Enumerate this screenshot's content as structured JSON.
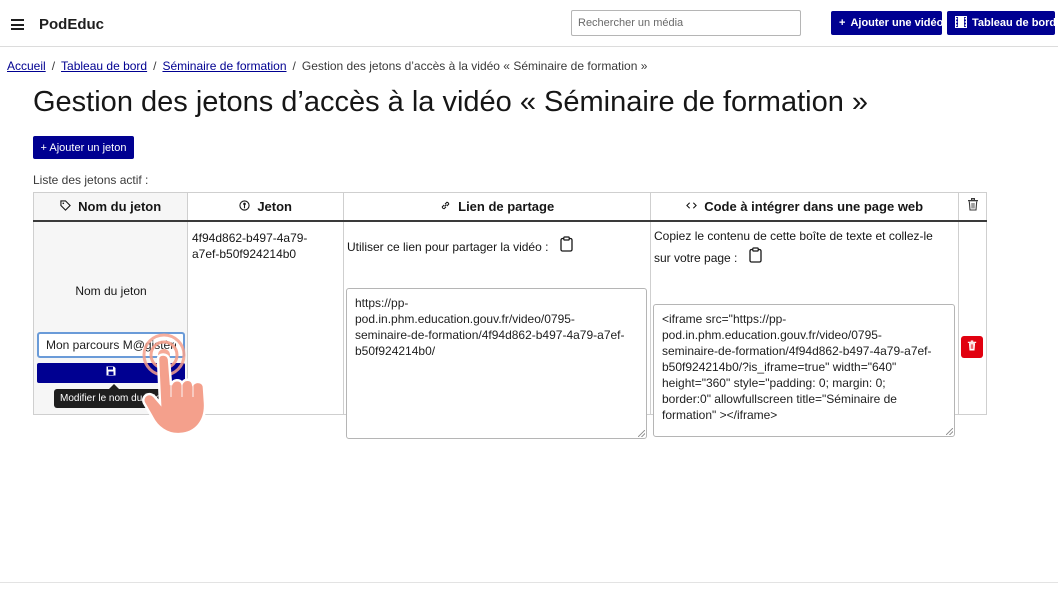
{
  "header": {
    "brand": "PodEduc",
    "search_placeholder": "Rechercher un média",
    "add_media_label": "Ajouter une vidéo",
    "dashboard_label": "Tableau de bord"
  },
  "breadcrumb": {
    "items": [
      "Accueil",
      "Tableau de bord",
      "Séminaire de formation"
    ],
    "current": "Gestion des jetons d’accès à la vidéo « Séminaire de formation »"
  },
  "page": {
    "title": "Gestion des jetons d’accès à la vidéo « Séminaire de formation »",
    "add_token_label": "+ Ajouter un jeton",
    "list_label": "Liste des jetons actif :"
  },
  "table": {
    "headers": {
      "name": "Nom du jeton",
      "token": "Jeton",
      "link": "Lien de partage",
      "embed": "Code à intégrer dans une page web"
    },
    "rows": [
      {
        "name_label": "Nom du jeton",
        "name_value": "Mon parcours M@gistère",
        "save_tooltip": "Modifier le nom du jeton",
        "token_lines": [
          "4f94d862-b497-4a79-",
          "a7ef-b50f924214b0"
        ],
        "link_help": "Utiliser ce lien pour partager la vidéo :",
        "link_lines": [
          "https://pp-",
          "pod.in.phm.education.gouv.fr/video/0795-",
          "seminaire-de-formation/4f94d862-b497-4a79-a7ef-",
          "b50f924214b0/"
        ],
        "embed_help_line1": "Copiez le contenu de cette boîte de texte et collez-le",
        "embed_help_line2": "sur votre page :",
        "embed_lines": [
          "<iframe src=\"https://pp-",
          "pod.in.phm.education.gouv.fr/video/0795-",
          "seminaire-de-formation/4f94d862-b497-4a79-a7ef-",
          "b50f924214b0/?is_iframe=true\" width=\"640\"",
          "height=\"360\" style=\"padding: 0; margin: 0;",
          "border:0\" allowfullscreen title=\"Séminaire de",
          "formation\" ></iframe>"
        ]
      }
    ]
  },
  "colors": {
    "primary": "#000091",
    "danger": "#e1000f",
    "tap_hint": "#f4a08c"
  },
  "icons": {
    "menu": "hamburger-icon",
    "add": "plus-icon",
    "dashboard": "film-icon",
    "name_header": "tag-icon",
    "token_header": "key-icon",
    "link_header": "link-icon",
    "embed_header": "code-icon",
    "delete_header": "trash-icon",
    "copy": "clipboard-icon",
    "save": "save-icon"
  }
}
